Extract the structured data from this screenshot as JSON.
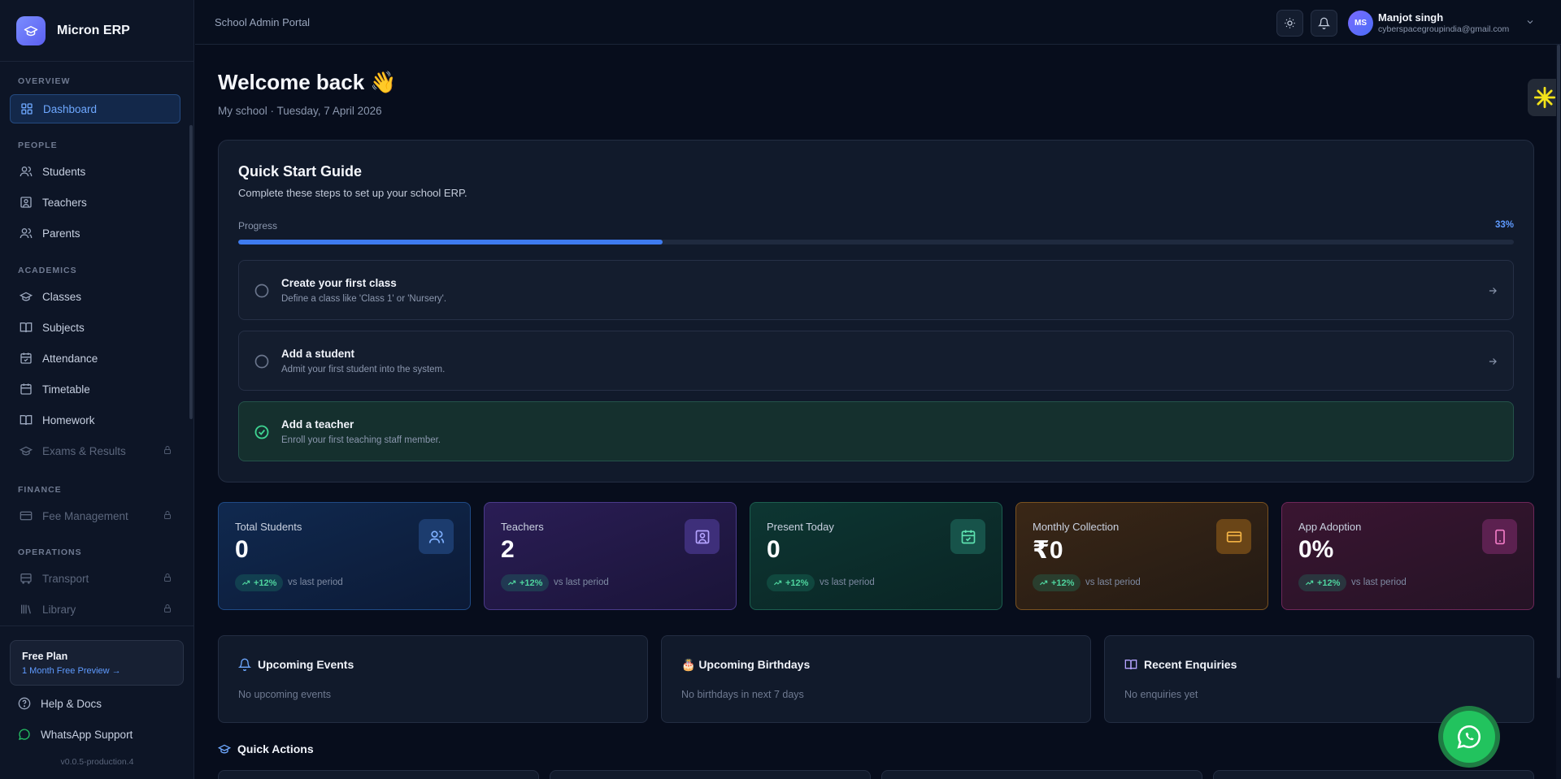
{
  "app": {
    "name": "Micron ERP"
  },
  "sidebar": {
    "sections": {
      "overview": "OVERVIEW",
      "people": "PEOPLE",
      "academics": "ACADEMICS",
      "finance": "FINANCE",
      "operations": "OPERATIONS"
    },
    "items": {
      "dashboard": "Dashboard",
      "students": "Students",
      "teachers": "Teachers",
      "parents": "Parents",
      "classes": "Classes",
      "subjects": "Subjects",
      "attendance": "Attendance",
      "timetable": "Timetable",
      "homework": "Homework",
      "exams": "Exams & Results",
      "fees": "Fee Management",
      "transport": "Transport",
      "library": "Library"
    },
    "plan": {
      "title": "Free Plan",
      "link": "1 Month Free Preview →"
    },
    "help": "Help & Docs",
    "whatsapp": "WhatsApp Support",
    "version": "v0.0.5-production.4"
  },
  "topbar": {
    "portal": "School Admin Portal",
    "user": {
      "initials": "MS",
      "name": "Manjot singh",
      "email": "cyberspacegroupindia@gmail.com"
    }
  },
  "main": {
    "welcome": "Welcome back 👋",
    "subtitle": "My school · Tuesday, 7 April 2026"
  },
  "quick_start": {
    "title": "Quick Start Guide",
    "description": "Complete these steps to set up your school ERP.",
    "progress_label": "Progress",
    "progress_text": "33%",
    "progress_value": 0.333,
    "steps": [
      {
        "title": "Create your first class",
        "desc": "Define a class like 'Class 1' or 'Nursery'.",
        "done": false
      },
      {
        "title": "Add a student",
        "desc": "Admit your first student into the system.",
        "done": false
      },
      {
        "title": "Add a teacher",
        "desc": "Enroll your first teaching staff member.",
        "done": true
      }
    ]
  },
  "stats": [
    {
      "label": "Total Students",
      "value": "0",
      "trend": "+12%",
      "note": "vs last period",
      "icon": "users-icon"
    },
    {
      "label": "Teachers",
      "value": "2",
      "trend": "+12%",
      "note": "vs last period",
      "icon": "contact-icon"
    },
    {
      "label": "Present Today",
      "value": "0",
      "trend": "+12%",
      "note": "vs last period",
      "icon": "calendar-check-icon"
    },
    {
      "label": "Monthly Collection",
      "value": "₹0",
      "trend": "+12%",
      "note": "vs last period",
      "icon": "card-icon"
    },
    {
      "label": "App Adoption",
      "value": "0%",
      "trend": "+12%",
      "note": "vs last period",
      "icon": "phone-icon"
    }
  ],
  "info": {
    "events": {
      "title": "Upcoming Events",
      "empty": "No upcoming events"
    },
    "birthdays": {
      "title": "🎂 Upcoming Birthdays",
      "empty": "No birthdays in next 7 days"
    },
    "enquiries": {
      "title": "Recent Enquiries",
      "empty": "No enquiries yet"
    }
  },
  "quick_actions": {
    "title": "Quick Actions"
  },
  "colors": {
    "accent": "#3e7bf0",
    "success": "#4fd49e"
  }
}
